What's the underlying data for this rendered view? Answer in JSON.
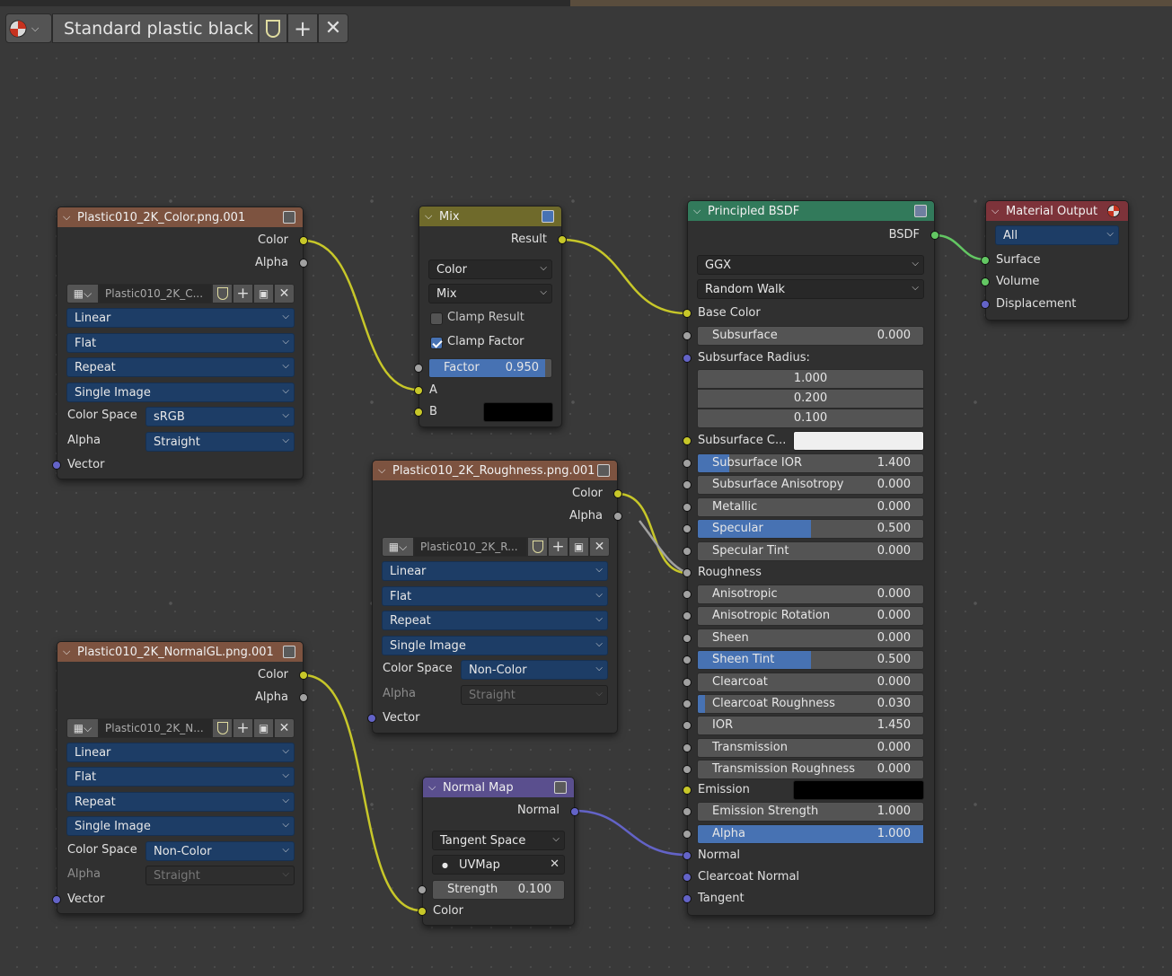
{
  "header": {
    "material_name": "Standard plastic black"
  },
  "nodes": {
    "color_tex": {
      "title": "Plastic010_2K_Color.png.001",
      "outputs": [
        "Color",
        "Alpha"
      ],
      "image_name": "Plastic010_2K_C...",
      "interpolation": "Linear",
      "projection": "Flat",
      "extension": "Repeat",
      "source": "Single Image",
      "color_space_label": "Color Space",
      "color_space": "sRGB",
      "alpha_label": "Alpha",
      "alpha": "Straight",
      "input": "Vector"
    },
    "mix": {
      "title": "Mix",
      "output": "Result",
      "type": "Color",
      "blend": "Mix",
      "clamp_result": "Clamp Result",
      "clamp_factor": "Clamp Factor",
      "factor_label": "Factor",
      "factor": "0.950",
      "factor_value": 0.95,
      "input_a": "A",
      "input_b": "B",
      "b_color": "#000000"
    },
    "bsdf": {
      "title": "Principled BSDF",
      "output": "BSDF",
      "distribution": "GGX",
      "subsurface_method": "Random Walk",
      "base_color": "Base Color",
      "subsurface": {
        "label": "Subsurface",
        "value": "0.000"
      },
      "radius_label": "Subsurface Radius:",
      "radius": [
        "1.000",
        "0.200",
        "0.100"
      ],
      "subsurface_color": "Subsurface C...",
      "fields": [
        {
          "label": "Subsurface IOR",
          "value": "1.400",
          "fill": 0.14
        },
        {
          "label": "Subsurface Anisotropy",
          "value": "0.000",
          "fill": 0
        },
        {
          "label": "Metallic",
          "value": "0.000",
          "fill": 0
        },
        {
          "label": "Specular",
          "value": "0.500",
          "fill": 0.5
        },
        {
          "label": "Specular Tint",
          "value": "0.000",
          "fill": 0
        }
      ],
      "roughness": "Roughness",
      "fields2": [
        {
          "label": "Anisotropic",
          "value": "0.000",
          "fill": 0
        },
        {
          "label": "Anisotropic Rotation",
          "value": "0.000",
          "fill": 0
        },
        {
          "label": "Sheen",
          "value": "0.000",
          "fill": 0
        },
        {
          "label": "Sheen Tint",
          "value": "0.500",
          "fill": 0.5
        },
        {
          "label": "Clearcoat",
          "value": "0.000",
          "fill": 0
        },
        {
          "label": "Clearcoat Roughness",
          "value": "0.030",
          "fill": 0.03
        },
        {
          "label": "IOR",
          "value": "1.450",
          "fill": 0
        },
        {
          "label": "Transmission",
          "value": "0.000",
          "fill": 0
        },
        {
          "label": "Transmission Roughness",
          "value": "0.000",
          "fill": 0
        }
      ],
      "emission": "Emission",
      "emission_strength": {
        "label": "Emission Strength",
        "value": "1.000"
      },
      "alpha": {
        "label": "Alpha",
        "value": "1.000",
        "fill": 1
      },
      "inputs_end": [
        "Normal",
        "Clearcoat Normal",
        "Tangent"
      ]
    },
    "output": {
      "title": "Material Output",
      "target": "All",
      "inputs": [
        "Surface",
        "Volume",
        "Displacement"
      ]
    },
    "rough_tex": {
      "title": "Plastic010_2K_Roughness.png.001",
      "outputs": [
        "Color",
        "Alpha"
      ],
      "image_name": "Plastic010_2K_R...",
      "interpolation": "Linear",
      "projection": "Flat",
      "extension": "Repeat",
      "source": "Single Image",
      "color_space_label": "Color Space",
      "color_space": "Non-Color",
      "alpha_label": "Alpha",
      "alpha": "Straight",
      "input": "Vector"
    },
    "normal_tex": {
      "title": "Plastic010_2K_NormalGL.png.001",
      "outputs": [
        "Color",
        "Alpha"
      ],
      "image_name": "Plastic010_2K_N...",
      "interpolation": "Linear",
      "projection": "Flat",
      "extension": "Repeat",
      "source": "Single Image",
      "color_space_label": "Color Space",
      "color_space": "Non-Color",
      "alpha_label": "Alpha",
      "alpha": "Straight",
      "input": "Vector"
    },
    "normal_map": {
      "title": "Normal Map",
      "output": "Normal",
      "space": "Tangent Space",
      "uv": "UVMap",
      "strength_label": "Strength",
      "strength": "0.100",
      "input": "Color"
    }
  },
  "colors": {
    "header_texture": "#7d5340",
    "header_mix": "#6f6a2b",
    "header_shader": "#327a5b",
    "header_output": "#7d333a",
    "header_vector": "#5a4f8e",
    "wire_color": "#c7c729",
    "wire_gray": "#a1a1a1",
    "wire_vector": "#6363c7",
    "wire_shader": "#63c763"
  }
}
